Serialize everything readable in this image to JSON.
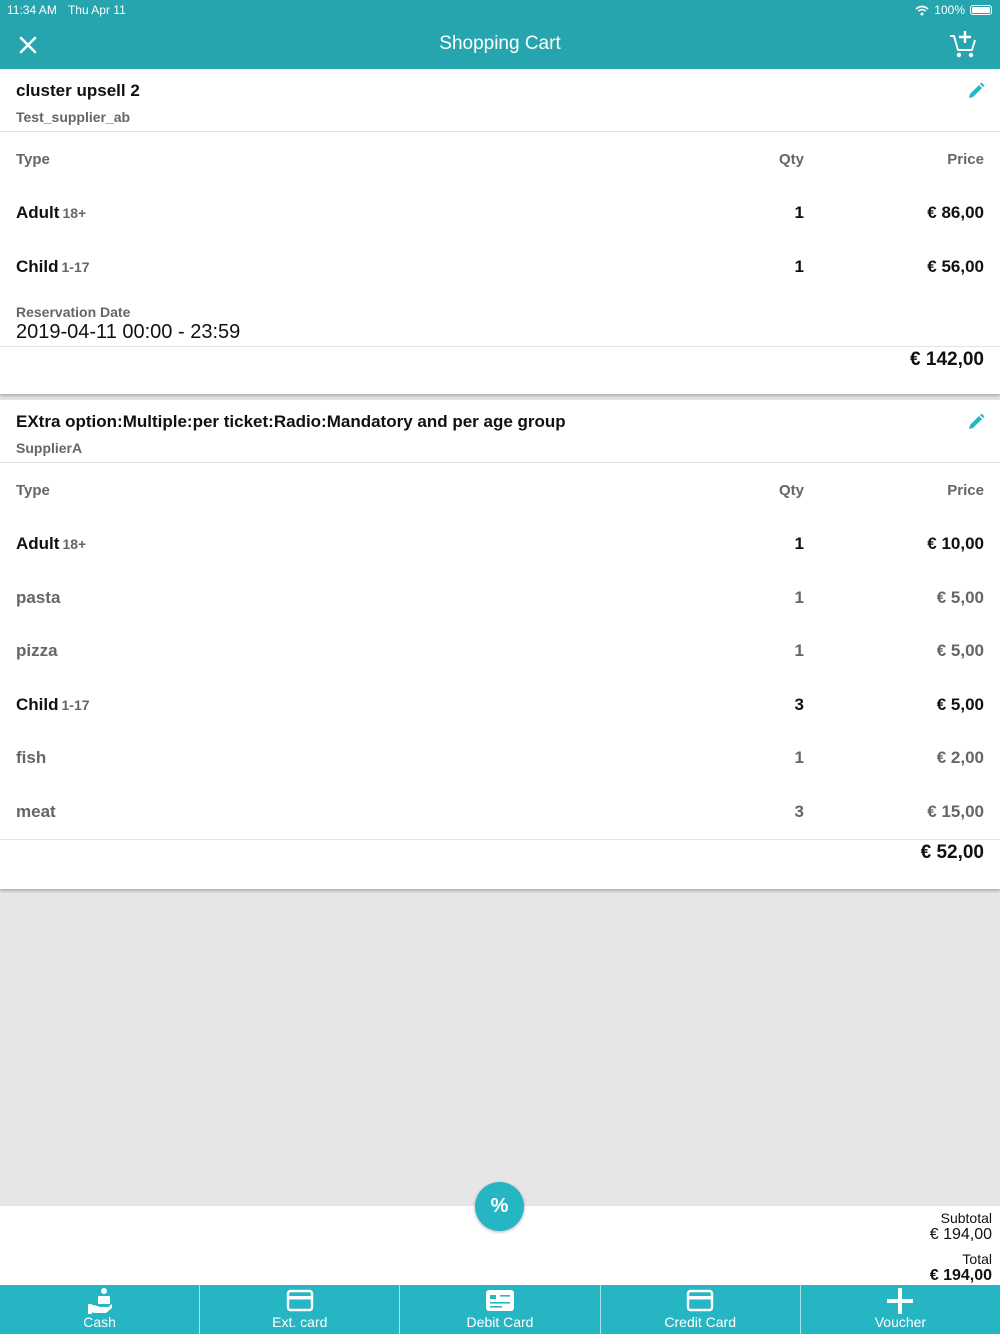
{
  "status_bar": {
    "time": "11:34 AM",
    "date": "Thu Apr 11",
    "battery": "100%"
  },
  "header": {
    "title": "Shopping Cart"
  },
  "colors": {
    "accent": "#26a5ae",
    "button": "#26b5c2"
  },
  "columns": {
    "type": "Type",
    "qty": "Qty",
    "price": "Price"
  },
  "cart_items": [
    {
      "name": "cluster upsell 2",
      "supplier": "Test_supplier_ab",
      "rows": [
        {
          "type": "Adult",
          "age": "18+",
          "qty": "1",
          "price": "€ 86,00"
        },
        {
          "type": "Child",
          "age": "1-17",
          "qty": "1",
          "price": "€ 56,00"
        }
      ],
      "reservation_label": "Reservation Date",
      "reservation_value": "2019-04-11 00:00 - 23:59",
      "total": "€ 142,00"
    },
    {
      "name": "EXtra option:Multiple:per ticket:Radio:Mandatory and per age group",
      "supplier": "SupplierA",
      "rows": [
        {
          "type": "Adult",
          "age": "18+",
          "qty": "1",
          "price": "€ 10,00"
        },
        {
          "type": "pasta",
          "age": "",
          "qty": "1",
          "price": "€ 5,00"
        },
        {
          "type": "pizza",
          "age": "",
          "qty": "1",
          "price": "€ 5,00"
        },
        {
          "type": "Child",
          "age": "1-17",
          "qty": "3",
          "price": "€ 5,00"
        },
        {
          "type": "fish",
          "age": "",
          "qty": "1",
          "price": "€ 2,00"
        },
        {
          "type": "meat",
          "age": "",
          "qty": "3",
          "price": "€ 15,00"
        }
      ],
      "total": "€ 52,00"
    }
  ],
  "discount_button": "%",
  "summary": {
    "subtotal_label": "Subtotal",
    "subtotal_value": "€ 194,00",
    "total_label": "Total",
    "total_value": "€ 194,00"
  },
  "payment_methods": [
    {
      "label": "Cash",
      "icon": "cash-hand-icon"
    },
    {
      "label": "Ext. card",
      "icon": "card-icon"
    },
    {
      "label": "Debit Card",
      "icon": "debit-card-icon"
    },
    {
      "label": "Credit Card",
      "icon": "credit-card-icon"
    },
    {
      "label": "Voucher",
      "icon": "plus-icon"
    }
  ]
}
